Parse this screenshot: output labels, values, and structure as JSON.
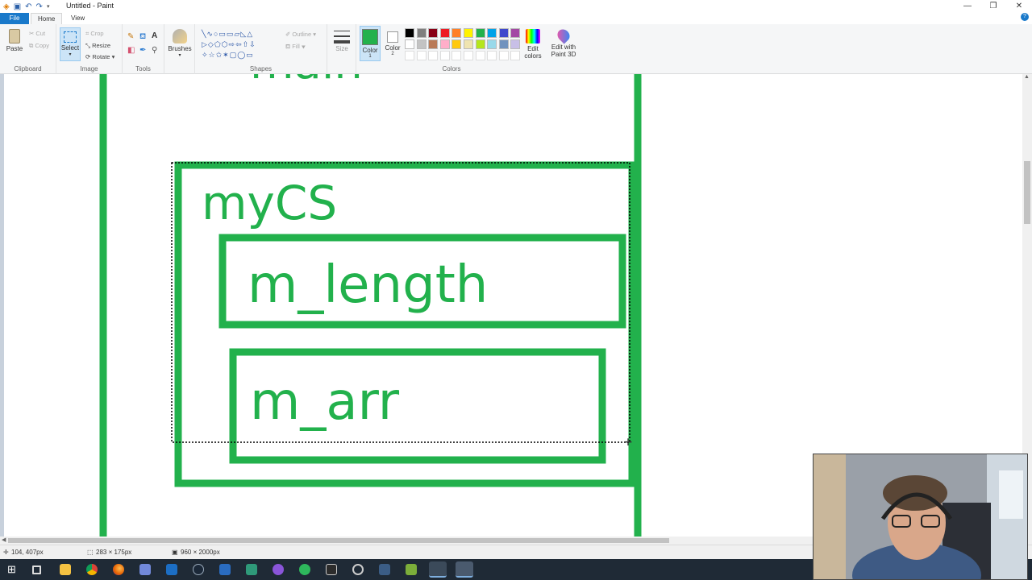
{
  "window": {
    "title": "Untitled - Paint",
    "minimize": "—",
    "restore": "❐",
    "close": "✕"
  },
  "tabs": {
    "file": "File",
    "home": "Home",
    "view": "View"
  },
  "help": "?",
  "ribbon": {
    "clipboard": {
      "label": "Clipboard",
      "paste": "Paste",
      "cut": "Cut",
      "copy": "Copy"
    },
    "image": {
      "label": "Image",
      "select": "Select",
      "crop": "Crop",
      "resize": "Resize",
      "rotate": "Rotate"
    },
    "tools": {
      "label": "Tools"
    },
    "brushes": {
      "label": "Brushes"
    },
    "shapes": {
      "label": "Shapes",
      "outline": "Outline",
      "fill": "Fill"
    },
    "size": {
      "label": "Size"
    },
    "color1": {
      "label": "Color",
      "sub": "1",
      "color": "#22b14c"
    },
    "color2": {
      "label": "Color",
      "sub": "2",
      "color": "#ffffff"
    },
    "colors": {
      "label": "Colors",
      "edit_colors": "Edit colors",
      "edit_paint3d": "Edit with Paint 3D",
      "palette": [
        "#000000",
        "#7f7f7f",
        "#880015",
        "#ed1c24",
        "#ff7f27",
        "#fff200",
        "#22b14c",
        "#00a2e8",
        "#3f48cc",
        "#a349a4",
        "#ffffff",
        "#c3c3c3",
        "#b97a57",
        "#ffaec9",
        "#ffc90e",
        "#efe4b0",
        "#b5e61d",
        "#99d9ea",
        "#7092be",
        "#c8bfe7"
      ]
    }
  },
  "canvas": {
    "labels": {
      "main": "main",
      "mycs": "myCS",
      "m_length": "m_length",
      "m_arr": "m_arr"
    },
    "stroke_color": "#22b14c"
  },
  "status": {
    "cursor": "104, 407px",
    "selection": "283 × 175px",
    "canvas_size": "960 × 2000px"
  },
  "taskbar": {
    "icons": [
      "windows-icon",
      "task-view-icon",
      "file-explorer-icon",
      "chrome-icon",
      "firefox-icon",
      "discord-icon",
      "visual-studio-icon",
      "steam-icon",
      "git-icon",
      "app-icon",
      "obs-icon",
      "spotify-icon",
      "notepad-icon",
      "clock-app-icon",
      "android-icon",
      "text-editor-icon",
      "paint-icon"
    ]
  }
}
